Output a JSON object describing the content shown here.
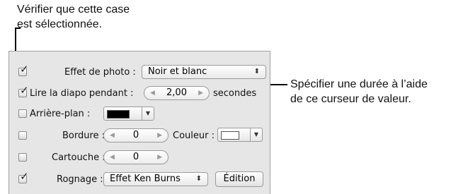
{
  "callouts": {
    "top_line1": "Vérifier que cette case",
    "top_line2": "est sélectionnée.",
    "right_line1": "Spécifier une durée à l’aide",
    "right_line2": "de ce curseur de valeur."
  },
  "settings": {
    "photo_effect": {
      "label": "Effet de photo :",
      "value": "Noir et blanc",
      "checked": true
    },
    "play_slideshow": {
      "label": "Lire la diapo pendant :",
      "value": "2,00",
      "unit": "secondes",
      "checked": true
    },
    "background": {
      "label": "Arrière-plan :",
      "color": "#000000",
      "checked": false
    },
    "border": {
      "label": "Bordure :",
      "value": "0",
      "color_label": "Couleur :",
      "color": "#ffffff",
      "checked": false
    },
    "matte": {
      "label": "Cartouche :",
      "value": "0",
      "checked": false
    },
    "crop": {
      "label": "Rognage :",
      "value": "Effet Ken Burns",
      "button_label": "Édition",
      "checked": true
    }
  },
  "glyphs": {
    "check": "✓",
    "left_arrow": "◀",
    "right_arrow": "▶",
    "updown": "⬍",
    "down": "▼"
  }
}
